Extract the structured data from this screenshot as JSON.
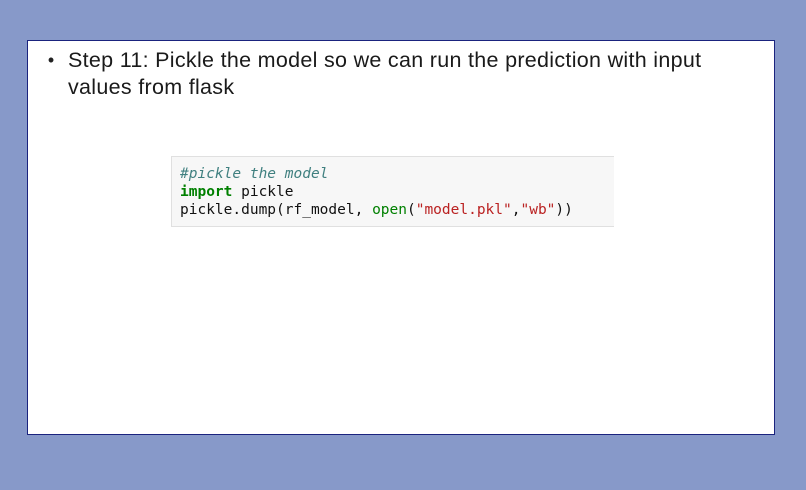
{
  "slide": {
    "bullet_symbol": "•",
    "bullet_text": "Step 11: Pickle the model so we can run the prediction with input values from flask"
  },
  "code": {
    "line1": {
      "comment": "#pickle the model"
    },
    "line2": {
      "keyword": "import",
      "module": " pickle"
    },
    "line3": {
      "call_prefix": "pickle.dump(rf_model, ",
      "builtin": "open",
      "open_paren": "(",
      "arg1": "\"model.pkl\"",
      "comma": ",",
      "arg2": "\"wb\"",
      "close": "))"
    }
  }
}
